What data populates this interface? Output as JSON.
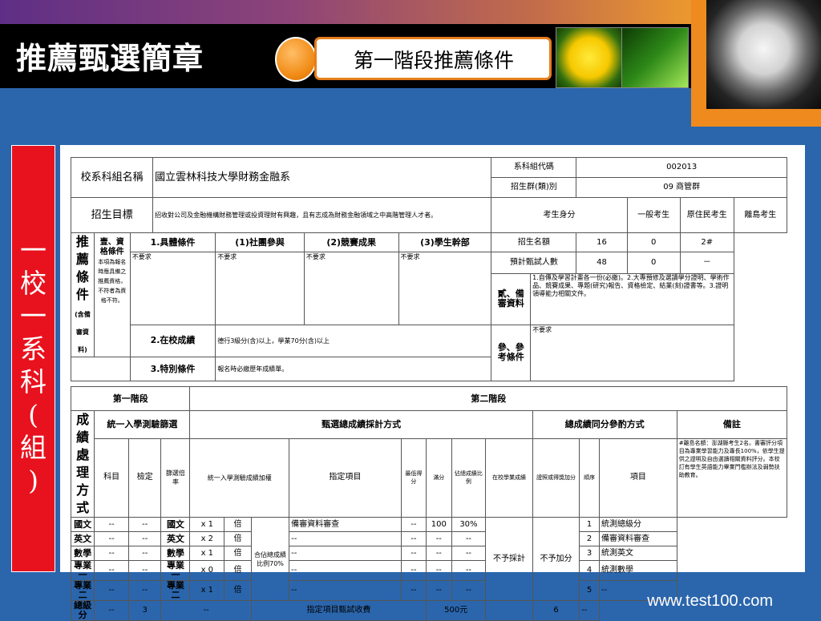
{
  "slide": {
    "title": "推薦甄選簡章",
    "subtitle": "第一階段推薦條件",
    "side_text": "一校一系科(組)",
    "footer": "www.test100.com"
  },
  "form": {
    "dept_label": "校系科組名稱",
    "dept_name": "國立雲林科技大學財務金融系",
    "code_label": "系科組代碼",
    "code_value": "002013",
    "group_label": "招生群(類)別",
    "group_value": "09 商管群",
    "goal_label": "招生目標",
    "goal_text": "招收對公司及金融機構財務管理或投資理財有興趣，且有志成為財務金融領域之中高階管理人才者。",
    "identity_label": "考生身分",
    "identity_cols": [
      "一般考生",
      "原住民考生",
      "離島考生"
    ],
    "quota_label": "招生名額",
    "quota_values": [
      "16",
      "0",
      "2#"
    ],
    "expected_label": "預計甄試人數",
    "expected_values": [
      "48",
      "0",
      "－"
    ],
    "recommend_label": "推薦條件",
    "recommend_note": "(含備審資料)",
    "qual_title": "壹、資格條件",
    "qual_note": "本項為報名時應具備之推薦資格，不符者為資格不符。",
    "specific_label": "1.具體條件",
    "club_label": "(1)社團參與",
    "contest_label": "(2)競賽成果",
    "cadre_label": "(3)學生幹部",
    "not_required": "不要求",
    "school_label": "2.在校成績",
    "school_text": "德行3級分(含)以上，學業70分(含)以上",
    "special_label": "3.特別條件",
    "special_text": "報名時必繳歷年成績單。",
    "docs_label": "貳、備審資料",
    "docs_text": "1.自傳及學習計畫各一份(必繳)。2.大專預修及選讀學分證明、學術作品、競賽成果、專題(研究)報告、資格檢定、結業(刻)證書等。3.證明領導能力相關文件。",
    "ref_label": "參、參考條件",
    "stage1_label": "第一階段",
    "stage2_label": "第二階段",
    "score_label": "成績處理方式",
    "exam_title": "統一入學測驗篩選",
    "calc_title": "甄選總成績採計方式",
    "tie_title": "總成績同分參酌方式",
    "remark_title": "備註",
    "col_subject": "科目",
    "col_check": "檢定",
    "col_screen": "篩選倍率",
    "col_weight": "統一入學測驗成績加權",
    "col_item": "指定項目",
    "col_min": "最低得分",
    "col_full": "滿分",
    "col_ratio": "佔總成績比例",
    "col_school": "在校學業成績",
    "col_bonus": "證照或得獎加分",
    "col_order": "順序",
    "col_tie_item": "項目",
    "subjects": [
      "國文",
      "英文",
      "數學",
      "專業一",
      "專業二"
    ],
    "total_label": "總級分",
    "total_screen": "3",
    "weights": [
      "1",
      "2",
      "1",
      "0",
      "1"
    ],
    "weight_unit": "倍",
    "weight_x": "x",
    "exam_ratio": "合佔總成績比例70%",
    "review_item": "備審資料審查",
    "review_full": "100",
    "review_ratio": "30%",
    "dash": "--",
    "no_count": "不予採計",
    "no_bonus": "不予加分",
    "fee_label": "指定項目甄試收費",
    "fee_value": "500元",
    "tie_orders": [
      "1",
      "2",
      "3",
      "4",
      "5",
      "6"
    ],
    "tie_items": [
      "統測總級分",
      "備審資料審查",
      "統測英文",
      "統測數學",
      "--",
      "--"
    ],
    "remark_text": "#離島名額：澎湖縣考生2名。書審評分項目為專業學習能力及專長100%，依學生提供之證明及自由選讀相關資料評分。本校訂有學生英語能力畢業門檻辦法及弱勢扶助教育。"
  }
}
